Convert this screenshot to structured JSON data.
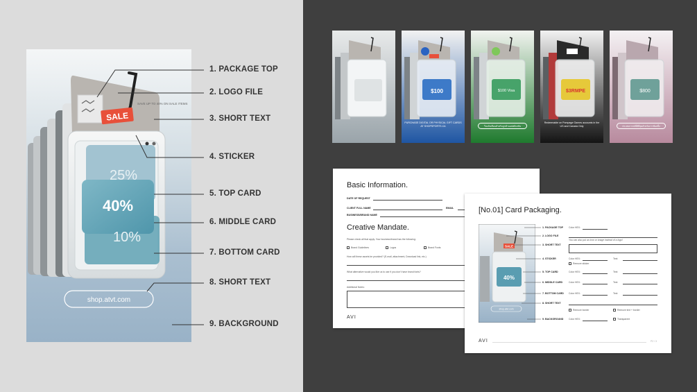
{
  "mockup": {
    "sticker_text": "SALE",
    "top_card_text": "40%",
    "middle_card_text": "25%",
    "bottom_card_text": "10%",
    "tiny_text": "SAVE UP TO 40% ON SALE ITEMS",
    "url_text": "shop.atvt.com"
  },
  "callouts": [
    {
      "label": "1. PACKAGE TOP"
    },
    {
      "label": "2. LOGO FILE"
    },
    {
      "label": "3. SHORT TEXT"
    },
    {
      "label": "4. STICKER"
    },
    {
      "label": "5. TOP CARD"
    },
    {
      "label": "6. MIDDLE CARD"
    },
    {
      "label": "7. BOTTOM CARD"
    },
    {
      "label": "8. SHORT TEXT"
    },
    {
      "label": "9. BACKGROUND"
    }
  ],
  "thumbnails": [
    {
      "card_text": "",
      "bottom_text": "",
      "pill_text": "",
      "bg_top": "#e8eaea",
      "bg_bottom": "#9aa4aa",
      "card_color": "#dfe3e4"
    },
    {
      "card_text": "$100",
      "bottom_text": "PURCHASE DIGITAL OR PHYSICAL GIFT CARDS AT SHOPSPORTS.CA",
      "pill_text": "",
      "bg_top": "#f2f2f2",
      "bg_bottom": "#1f56a3",
      "card_color": "#3d7ac8"
    },
    {
      "card_text": "$100 Visa",
      "bottom_text": "",
      "pill_text": "ใบแจ้งเตือนสำหรับลูกค้าแอปพลิเคชัน",
      "bg_top": "#f1f3ef",
      "bg_bottom": "#1f7a2e",
      "card_color": "#47a36a"
    },
    {
      "card_text": "$3RMPE",
      "bottom_text": "Redeemable on Pompage Games accounts in the US and Canada Only",
      "pill_text": "",
      "bg_top": "#f2f2f2",
      "bg_bottom": "#141414",
      "card_color": "#e6c93a"
    },
    {
      "card_text": "$800",
      "bottom_text": "",
      "pill_text": "ประสบการณ์ที่ดีที่สุดสำหรับการช้อปปิ้ง",
      "bg_top": "#f4f1f3",
      "bg_bottom": "#b88a9e",
      "card_color": "#6fa19a"
    }
  ],
  "form1": {
    "title": "Basic Information.",
    "date_label": "DATE OF REQUEST",
    "client_label": "CLIENT FULL NAME",
    "email_label": "EMAIL",
    "business_label": "BUSINESS/BRAND NAME",
    "mandate_title": "Creative Mandate.",
    "check_prompt": "Please check all that apply. Your business/brand has the following:",
    "options": [
      "Brand Guidelines",
      "Logos",
      "Brand Fonts"
    ],
    "assets_prompt": "How will these assets be provided? (E-mail, attachment, Download link, etc.)",
    "alt_prompt": "What alternative would you like us to use if you don't have brand fonts?",
    "notes_label": "Additional Notes:",
    "logo": "AVI"
  },
  "form2": {
    "title": "[No.01] Card Packaging.",
    "items": [
      {
        "label": "1. PACKAGE TOP"
      },
      {
        "label": "2. LOGO FILE"
      },
      {
        "label": "3. SHORT TEXT"
      },
      {
        "label": "4. STICKER"
      },
      {
        "label": "5. TOP CARD"
      },
      {
        "label": "6. MIDDLE CARD"
      },
      {
        "label": "7. BOTTOM CARD"
      },
      {
        "label": "8. SHORT TEXT"
      },
      {
        "label": "9. BACKGROUND"
      }
    ],
    "color_hex_label": "Color HEX:",
    "text_label": "Text:",
    "logo_note": "You can also put an icon or image instead of a logo!",
    "remove_sticker": "Remove sticker",
    "remove_border": "Remove border",
    "remove_text_border": "Remove text + border",
    "transparent": "Transparent",
    "mini_sticker": "SALE",
    "mini_card": "40%",
    "mini_pill": "shop.atvt.com",
    "logo": "AVI",
    "page": "P2 / 3"
  }
}
